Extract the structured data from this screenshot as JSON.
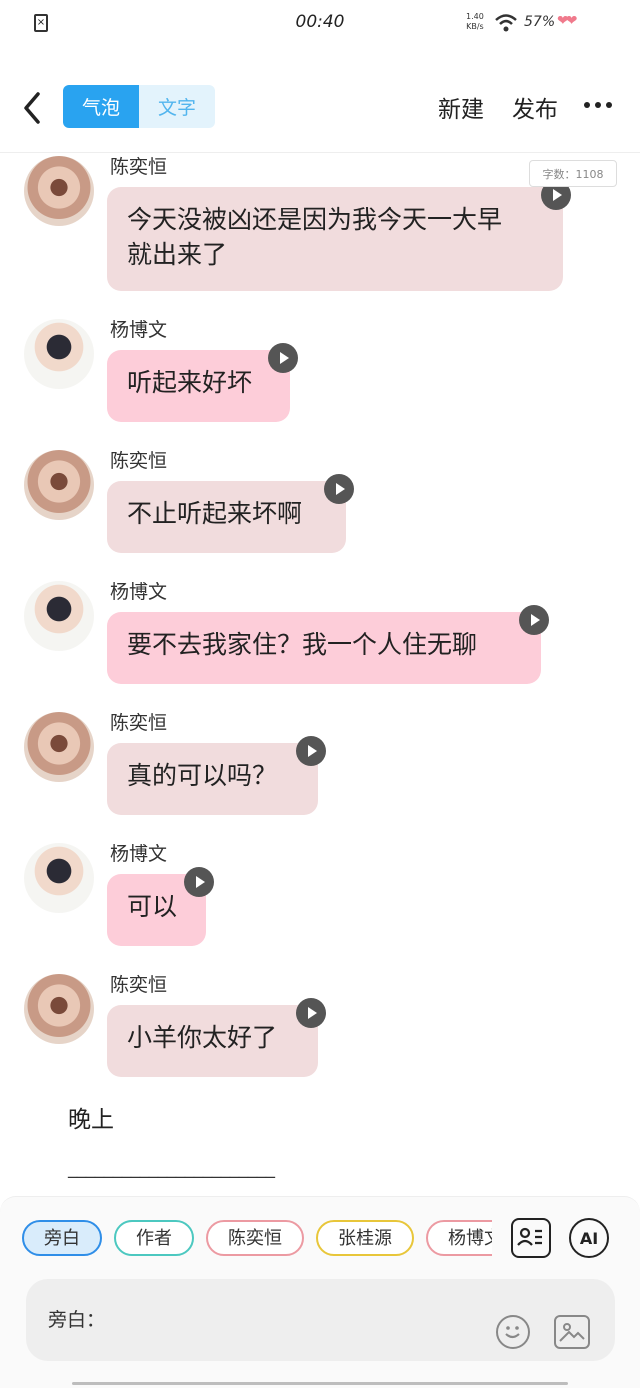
{
  "status_bar": {
    "sim_icon": "sim-error-icon",
    "time": "00:40",
    "net_speed_value": "1.40",
    "net_speed_unit": "KB/s",
    "wifi_icon": "wifi-icon",
    "battery": "57%",
    "battery_icon": "heart-battery-icon"
  },
  "nav": {
    "back_icon": "chevron-left-icon",
    "tab_bubble": "气泡",
    "tab_text": "文字",
    "new_label": "新建",
    "publish_label": "发布",
    "more_icon": "more-horizontal-icon"
  },
  "word_count": "字数：1108",
  "messages": [
    {
      "speaker": "陈奕恒",
      "text_line1": "今天没被凶还是因为我今天一大早",
      "text_line2": "就出来了"
    },
    {
      "speaker": "杨博文",
      "text": "听起来好坏"
    },
    {
      "speaker": "陈奕恒",
      "text": "不止听起来坏啊"
    },
    {
      "speaker": "杨博文",
      "text": "要不去我家住？我一个人住无聊"
    },
    {
      "speaker": "陈奕恒",
      "text": "真的可以吗？"
    },
    {
      "speaker": "杨博文",
      "text": "可以"
    },
    {
      "speaker": "陈奕恒",
      "text": "小羊你太好了"
    }
  ],
  "narration": "晚上",
  "separator": "_______________________",
  "bottom_panel": {
    "chips": [
      "旁白",
      "作者",
      "陈奕恒",
      "张桂源",
      "杨博文"
    ],
    "role_icon": "contact-card-icon",
    "ai_label": "AI",
    "input_prefix": "旁白：",
    "emoji_icon": "smiley-icon",
    "image_icon": "image-icon"
  },
  "colors": {
    "accent": "#29a3f0",
    "bubble_chen": "#f1dcdd",
    "bubble_yang": "#fdcdd9"
  }
}
